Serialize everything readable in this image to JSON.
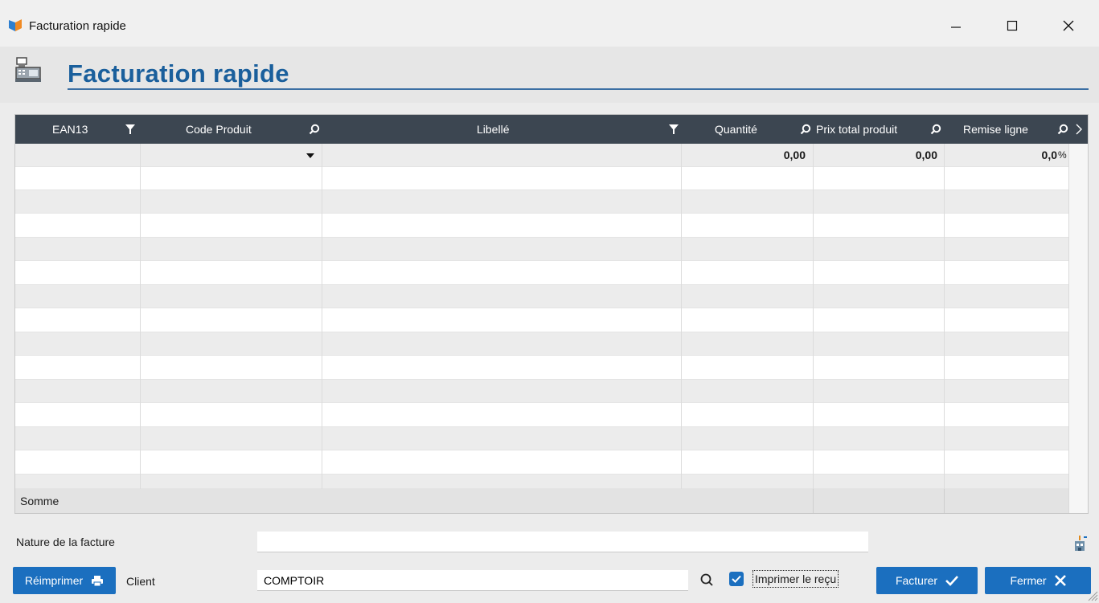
{
  "window": {
    "title": "Facturation rapide"
  },
  "header": {
    "title": "Facturation rapide"
  },
  "colors": {
    "accent": "#1b6fbf",
    "header_bg": "#3c4651",
    "title_blue": "#1a5f9c"
  },
  "grid": {
    "columns": [
      {
        "label": "EAN13",
        "icon": "filter-icon"
      },
      {
        "label": "Code Produit",
        "icon": "search-icon"
      },
      {
        "label": "Libellé",
        "icon": "filter-icon"
      },
      {
        "label": "Quantité",
        "icon": "search-icon"
      },
      {
        "label": "Prix total produit",
        "icon": "search-icon"
      },
      {
        "label": "Remise ligne",
        "icon": "search-icon"
      }
    ],
    "first_row": {
      "quantite": "0,00",
      "prix_total": "0,00",
      "remise_value": "0,0",
      "remise_unit": "%"
    },
    "somme_label": "Somme"
  },
  "form": {
    "nature_label": "Nature de la facture",
    "nature_value": "",
    "client_label": "Client",
    "client_value": "COMPTOIR",
    "print_receipt_label": "Imprimer le reçu",
    "print_receipt_checked": true
  },
  "buttons": {
    "reprint": "Réimprimer",
    "invoice": "Facturer",
    "close": "Fermer"
  }
}
